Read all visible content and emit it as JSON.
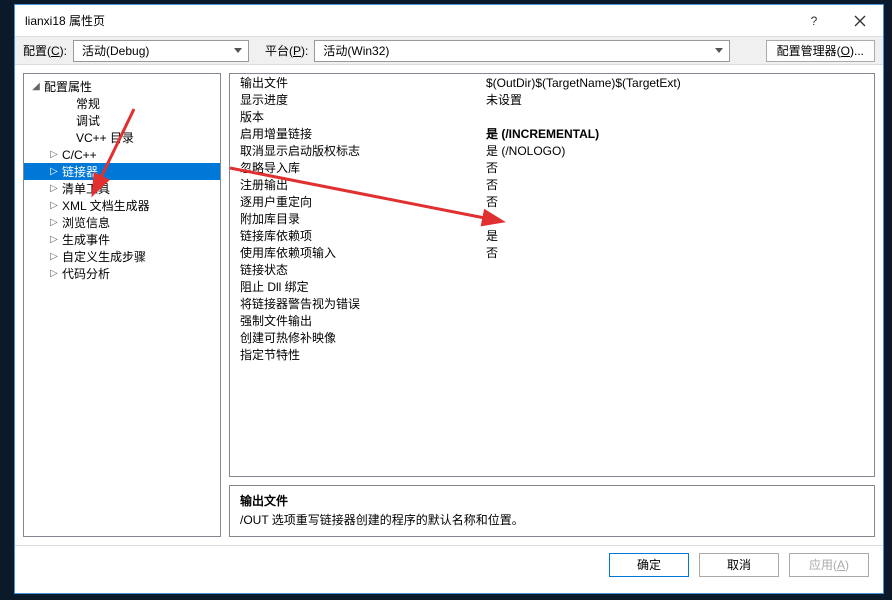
{
  "title": "lianxi18 属性页",
  "toolbar": {
    "config_label": "配置(<u>C</u>):",
    "config_value": "活动(Debug)",
    "platform_label": "平台(<u>P</u>):",
    "platform_value": "活动(Win32)",
    "manager_label": "配置管理器(<u>O</u>)..."
  },
  "tree": {
    "root": "配置属性",
    "items": [
      {
        "label": "常规",
        "exp": "",
        "level": 2
      },
      {
        "label": "调试",
        "exp": "",
        "level": 2
      },
      {
        "label": "VC++ 目录",
        "exp": "",
        "level": 2
      },
      {
        "label": "C/C++",
        "exp": "▷",
        "level": 1
      },
      {
        "label": "链接器",
        "exp": "▷",
        "level": 1,
        "selected": true
      },
      {
        "label": "清单工具",
        "exp": "▷",
        "level": 1
      },
      {
        "label": "XML 文档生成器",
        "exp": "▷",
        "level": 1
      },
      {
        "label": "浏览信息",
        "exp": "▷",
        "level": 1
      },
      {
        "label": "生成事件",
        "exp": "▷",
        "level": 1
      },
      {
        "label": "自定义生成步骤",
        "exp": "▷",
        "level": 1
      },
      {
        "label": "代码分析",
        "exp": "▷",
        "level": 1
      }
    ]
  },
  "props": [
    {
      "label": "输出文件",
      "value": "$(OutDir)$(TargetName)$(TargetExt)",
      "bold": false
    },
    {
      "label": "显示进度",
      "value": "未设置",
      "bold": false
    },
    {
      "label": "版本",
      "value": "",
      "bold": false
    },
    {
      "label": "启用增量链接",
      "value": "是 (/INCREMENTAL)",
      "bold": true
    },
    {
      "label": "取消显示启动版权标志",
      "value": "是 (/NOLOGO)",
      "bold": false
    },
    {
      "label": "忽略导入库",
      "value": "否",
      "bold": false
    },
    {
      "label": "注册输出",
      "value": "否",
      "bold": false
    },
    {
      "label": "逐用户重定向",
      "value": "否",
      "bold": false
    },
    {
      "label": "附加库目录",
      "value": "",
      "bold": false
    },
    {
      "label": "链接库依赖项",
      "value": "是",
      "bold": false
    },
    {
      "label": "使用库依赖项输入",
      "value": "否",
      "bold": false
    },
    {
      "label": "链接状态",
      "value": "",
      "bold": false
    },
    {
      "label": "阻止 Dll 绑定",
      "value": "",
      "bold": false
    },
    {
      "label": "将链接器警告视为错误",
      "value": "",
      "bold": false
    },
    {
      "label": "强制文件输出",
      "value": "",
      "bold": false
    },
    {
      "label": "创建可热修补映像",
      "value": "",
      "bold": false
    },
    {
      "label": "指定节特性",
      "value": "",
      "bold": false
    }
  ],
  "desc": {
    "title": "输出文件",
    "text": "/OUT 选项重写链接器创建的程序的默认名称和位置。"
  },
  "footer": {
    "ok": "确定",
    "cancel": "取消",
    "apply": "应用(<u>A</u>)"
  }
}
